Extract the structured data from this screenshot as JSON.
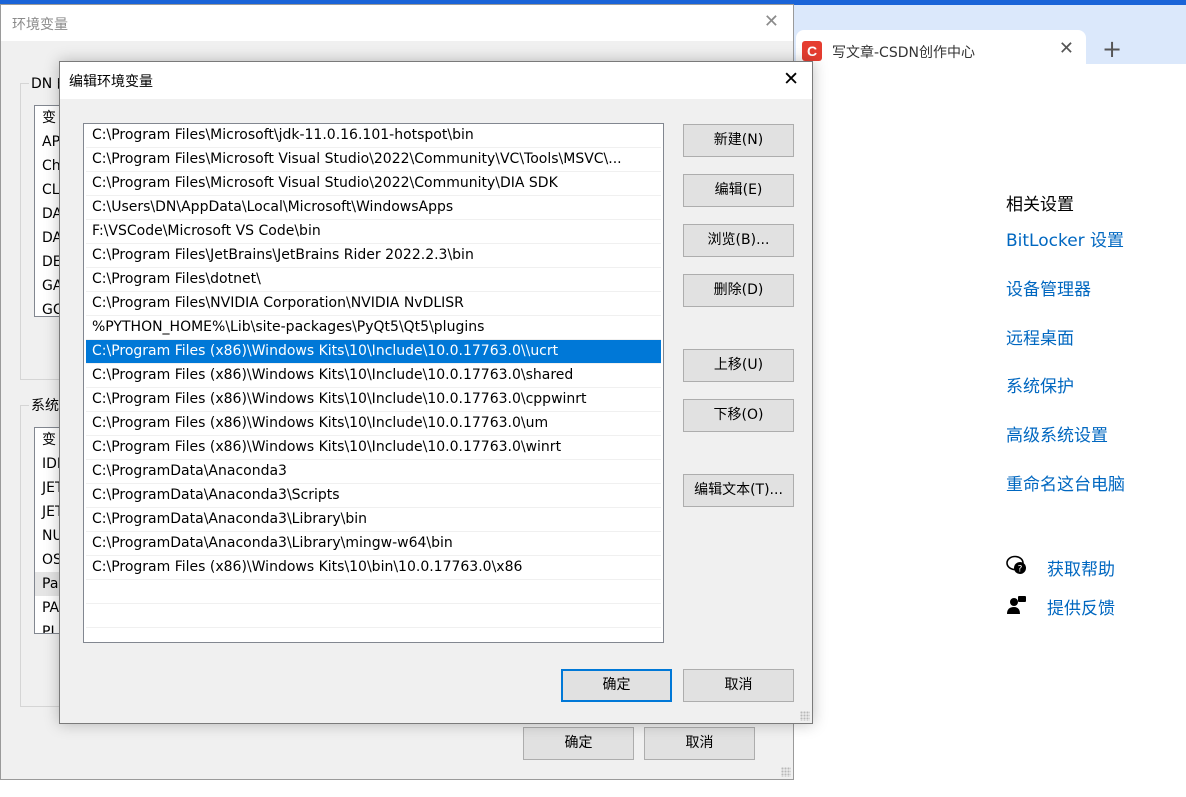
{
  "browser": {
    "tab_title": "写文章-CSDN创作中心",
    "favicon_letter": "C",
    "tab_close": "✕",
    "new_tab": "+"
  },
  "settings": {
    "heading": "相关设置",
    "links": [
      "BitLocker 设置",
      "设备管理器",
      "远程桌面",
      "系统保护",
      "高级系统设置",
      "重命名这台电脑"
    ],
    "help": "获取帮助",
    "feedback": "提供反馈"
  },
  "outer_dialog": {
    "title": "环境变量",
    "close": "✕",
    "user_group_label": "DN 的",
    "user_list": [
      "变",
      "AP",
      "Ch",
      "CL",
      "DA",
      "DA",
      "DE",
      "GA",
      "GC"
    ],
    "system_group_label": "系统变",
    "system_list": [
      "变",
      "IDI",
      "JET",
      "JET",
      "NU",
      "OS",
      "Pa",
      "PA",
      "PL"
    ],
    "ok": "确定",
    "cancel": "取消"
  },
  "edit_dialog": {
    "title": "编辑环境变量",
    "close": "✕",
    "paths": [
      "C:\\Program Files\\Microsoft\\jdk-11.0.16.101-hotspot\\bin",
      "C:\\Program Files\\Microsoft Visual Studio\\2022\\Community\\VC\\Tools\\MSVC\\...",
      "C:\\Program Files\\Microsoft Visual Studio\\2022\\Community\\DIA SDK",
      "C:\\Users\\DN\\AppData\\Local\\Microsoft\\WindowsApps",
      "F:\\VSCode\\Microsoft VS Code\\bin",
      "C:\\Program Files\\JetBrains\\JetBrains Rider 2022.2.3\\bin",
      "C:\\Program Files\\dotnet\\",
      "C:\\Program Files\\NVIDIA Corporation\\NVIDIA NvDLISR",
      "%PYTHON_HOME%\\Lib\\site-packages\\PyQt5\\Qt5\\plugins",
      "C:\\Program Files (x86)\\Windows Kits\\10\\Include\\10.0.17763.0\\\\ucrt",
      "C:\\Program Files (x86)\\Windows Kits\\10\\Include\\10.0.17763.0\\shared",
      "C:\\Program Files (x86)\\Windows Kits\\10\\Include\\10.0.17763.0\\cppwinrt",
      "C:\\Program Files (x86)\\Windows Kits\\10\\Include\\10.0.17763.0\\um",
      "C:\\Program Files (x86)\\Windows Kits\\10\\Include\\10.0.17763.0\\winrt",
      "C:\\ProgramData\\Anaconda3",
      "C:\\ProgramData\\Anaconda3\\Scripts",
      "C:\\ProgramData\\Anaconda3\\Library\\bin",
      "C:\\ProgramData\\Anaconda3\\Library\\mingw-w64\\bin",
      "C:\\Program Files (x86)\\Windows Kits\\10\\bin\\10.0.17763.0\\x86",
      "",
      ""
    ],
    "selected_index": 9,
    "buttons": {
      "new": "新建(N)",
      "edit": "编辑(E)",
      "browse": "浏览(B)...",
      "delete": "删除(D)",
      "move_up": "上移(U)",
      "move_down": "下移(O)",
      "edit_text": "编辑文本(T)..."
    },
    "ok": "确定",
    "cancel": "取消"
  },
  "colors": {
    "selection": "#0078d7",
    "link": "#0067c0",
    "browser_accent": "#1a64d8",
    "csdn_red": "#e53d30"
  }
}
